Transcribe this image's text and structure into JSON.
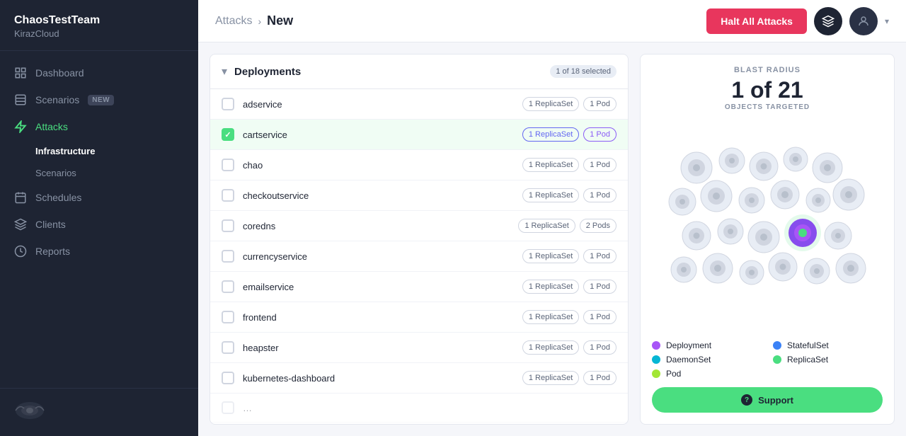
{
  "sidebar": {
    "team": "ChaosTestTeam",
    "org": "KirazCloud",
    "nav": [
      {
        "id": "dashboard",
        "label": "Dashboard",
        "icon": "grid",
        "active": false
      },
      {
        "id": "scenarios",
        "label": "Scenarios",
        "icon": "file",
        "active": false,
        "badge": "NEW"
      },
      {
        "id": "attacks",
        "label": "Attacks",
        "icon": "zap",
        "active": true
      },
      {
        "id": "sub-infrastructure",
        "label": "Infrastructure",
        "sub": true,
        "active": true
      },
      {
        "id": "sub-scenarios",
        "label": "Scenarios",
        "sub": true,
        "active": false
      },
      {
        "id": "schedules",
        "label": "Schedules",
        "icon": "calendar",
        "active": false
      },
      {
        "id": "clients",
        "label": "Clients",
        "icon": "layers",
        "active": false
      },
      {
        "id": "reports",
        "label": "Reports",
        "icon": "pie",
        "active": false
      }
    ]
  },
  "header": {
    "breadcrumb_parent": "Attacks",
    "breadcrumb_sep": ">",
    "breadcrumb_current": "New",
    "halt_button": "Halt All Attacks"
  },
  "deployments": {
    "title": "Deployments",
    "selected_badge": "1 of 18 selected",
    "items": [
      {
        "name": "adservice",
        "tags": [
          "1 ReplicaSet",
          "1 Pod"
        ],
        "checked": false,
        "highlighted": false
      },
      {
        "name": "cartservice",
        "tags": [
          "1 ReplicaSet",
          "1 Pod"
        ],
        "checked": true,
        "highlighted": true
      },
      {
        "name": "chao",
        "tags": [
          "1 ReplicaSet",
          "1 Pod"
        ],
        "checked": false,
        "highlighted": false
      },
      {
        "name": "checkoutservice",
        "tags": [
          "1 ReplicaSet",
          "1 Pod"
        ],
        "checked": false,
        "highlighted": false
      },
      {
        "name": "coredns",
        "tags": [
          "1 ReplicaSet",
          "2 Pods"
        ],
        "checked": false,
        "highlighted": false
      },
      {
        "name": "currencyservice",
        "tags": [
          "1 ReplicaSet",
          "1 Pod"
        ],
        "checked": false,
        "highlighted": false
      },
      {
        "name": "emailservice",
        "tags": [
          "1 ReplicaSet",
          "1 Pod"
        ],
        "checked": false,
        "highlighted": false
      },
      {
        "name": "frontend",
        "tags": [
          "1 ReplicaSet",
          "1 Pod"
        ],
        "checked": false,
        "highlighted": false
      },
      {
        "name": "heapster",
        "tags": [
          "1 ReplicaSet",
          "1 Pod"
        ],
        "checked": false,
        "highlighted": false
      },
      {
        "name": "kubernetes-dashboard",
        "tags": [
          "1 ReplicaSet",
          "1 Pod"
        ],
        "checked": false,
        "highlighted": false
      }
    ]
  },
  "blast": {
    "title": "BLAST RADIUS",
    "count": "1 of 21",
    "subtitle": "OBJECTS TARGETED",
    "legend": [
      {
        "label": "Deployment",
        "color": "#a855f7"
      },
      {
        "label": "StatefulSet",
        "color": "#3b82f6"
      },
      {
        "label": "DaemonSet",
        "color": "#06b6d4"
      },
      {
        "label": "ReplicaSet",
        "color": "#4ade80"
      },
      {
        "label": "Pod",
        "color": "#a3e635"
      }
    ]
  },
  "support": {
    "label": "Support"
  }
}
